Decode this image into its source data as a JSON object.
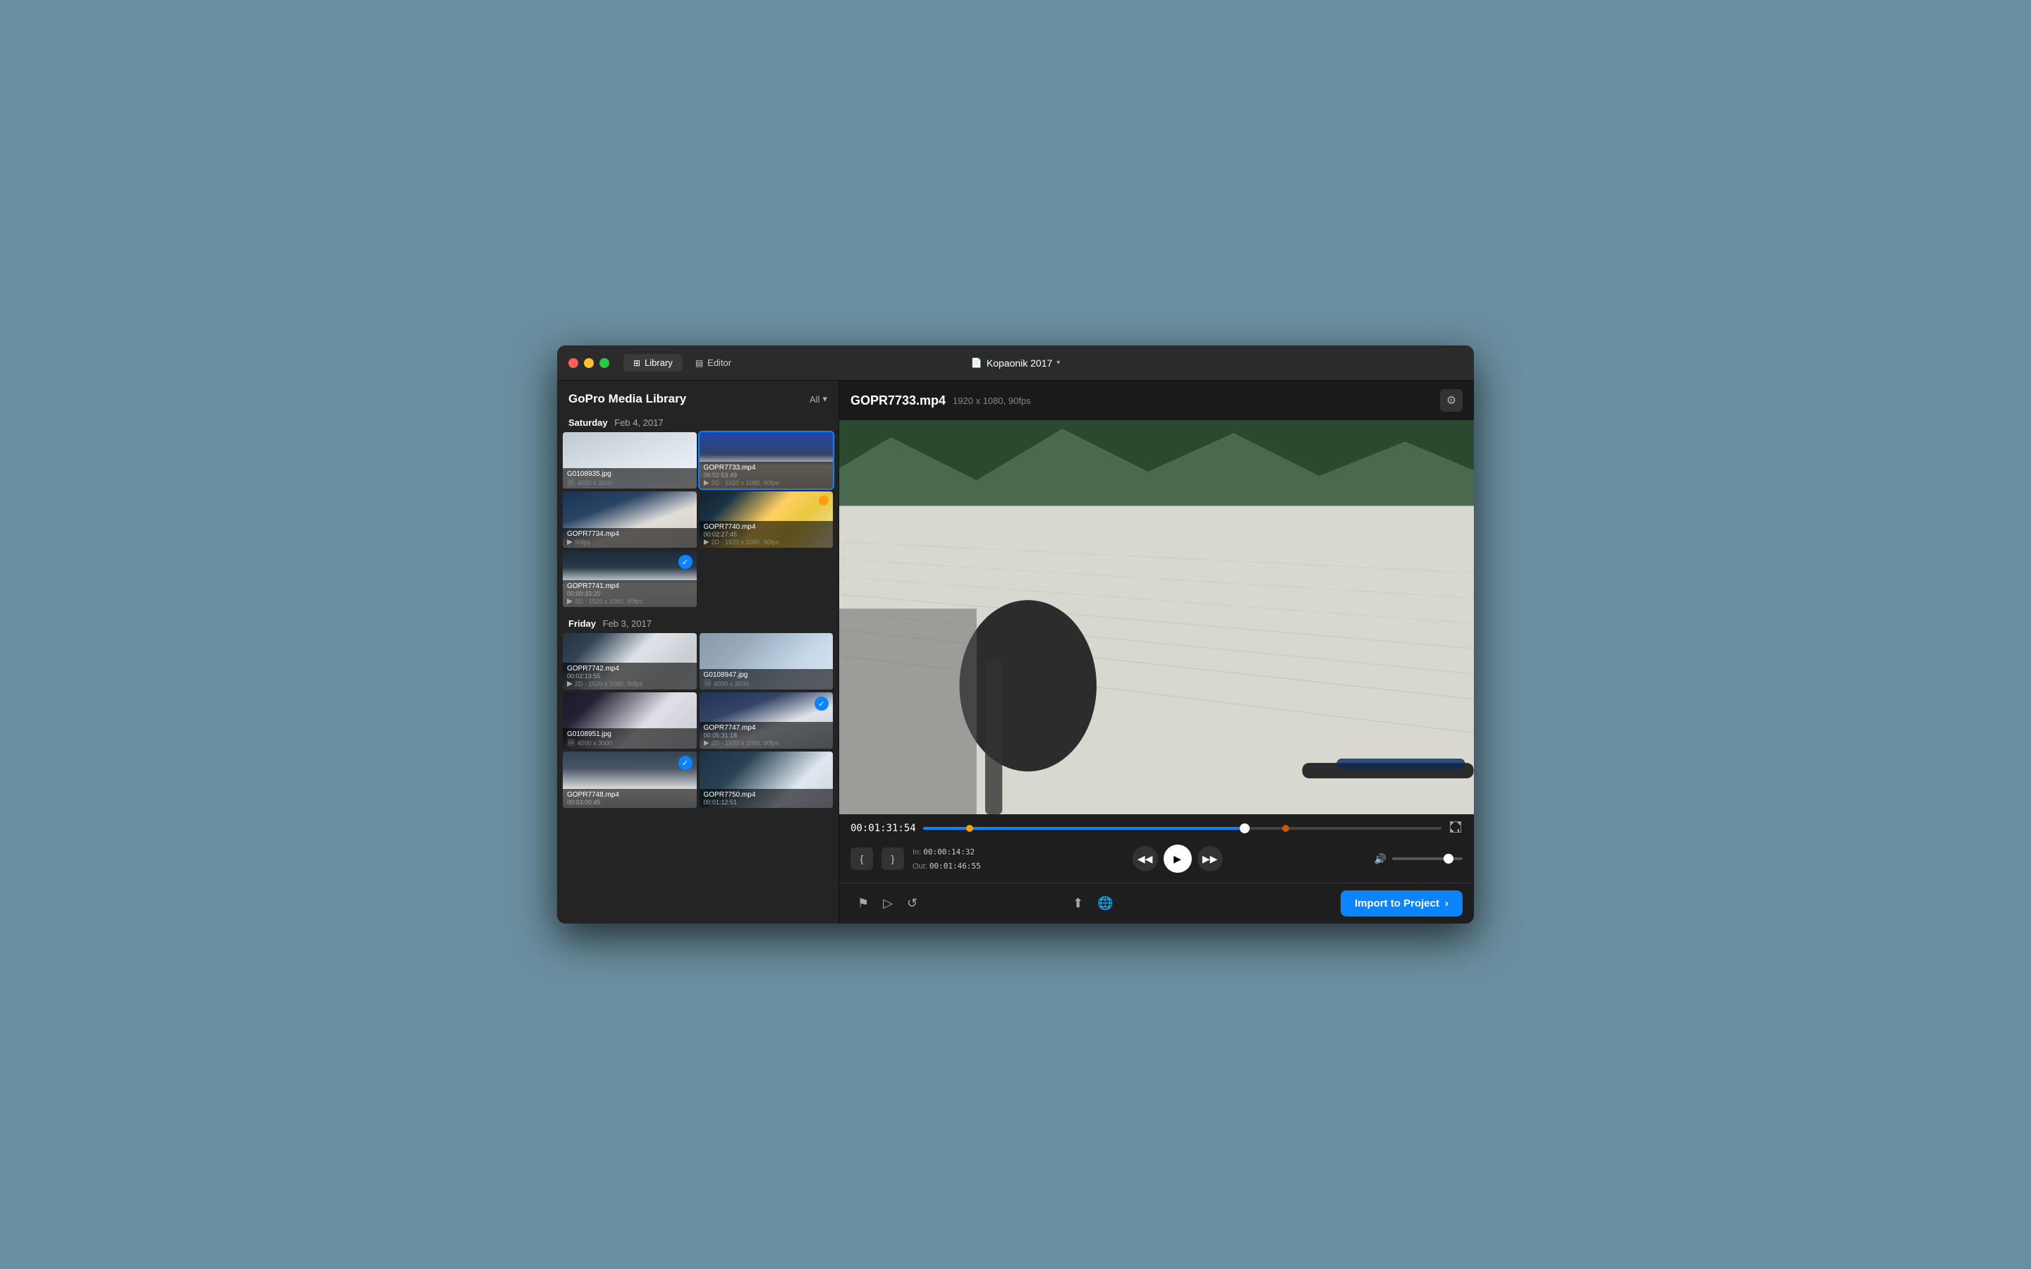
{
  "window": {
    "title": "Kopaonik 2017"
  },
  "titlebar": {
    "traffic_lights": [
      "red",
      "yellow",
      "green"
    ],
    "tabs": [
      {
        "id": "library",
        "label": "Library",
        "active": true
      },
      {
        "id": "editor",
        "label": "Editor",
        "active": false
      }
    ],
    "project_name": "Kopaonik 2017",
    "chevron": "▾"
  },
  "sidebar": {
    "title": "GoPro Media Library",
    "filter_label": "All",
    "days": [
      {
        "day": "Saturday",
        "date": "Feb 4, 2017",
        "items": [
          {
            "id": "G0108935",
            "filename": "G0108935.jpg",
            "type": "photo",
            "resolution": "4000 x 3000",
            "selected": false,
            "checked": false,
            "thumb": "thumb-photo-1"
          },
          {
            "id": "GOPR7733",
            "filename": "GOPR7733.mp4",
            "duration": "00:02:53:49",
            "type": "video",
            "meta": "2D · 1920 x 1080, 90fps",
            "selected": true,
            "checked": false,
            "thumb": "thumb-ski-2"
          },
          {
            "id": "GOPR7734",
            "filename": "GOPR7734.mp4",
            "type": "video",
            "meta": "90fps",
            "selected": false,
            "checked": false,
            "thumb": "thumb-ski-3"
          },
          {
            "id": "GOPR7740",
            "filename": "GOPR7740.mp4",
            "duration": "00:02:27:45",
            "type": "video",
            "meta": "2D · 1920 x 1080, 90fps",
            "selected": false,
            "checked": false,
            "badge": "orange",
            "thumb": "thumb-ski-4"
          },
          {
            "id": "GOPR7741",
            "filename": "GOPR7741.mp4",
            "duration": "00:00:33:20",
            "type": "video",
            "meta": "2D · 1920 x 1080, 90fps",
            "selected": false,
            "checked": true,
            "thumb": "thumb-ski-5"
          }
        ]
      },
      {
        "day": "Friday",
        "date": "Feb 3, 2017",
        "items": [
          {
            "id": "GOPR7742",
            "filename": "GOPR7742.mp4",
            "duration": "00:02:19:55",
            "type": "video",
            "meta": "2D · 1920 x 1080, 90fps",
            "selected": false,
            "checked": false,
            "thumb": "thumb-ski-6"
          },
          {
            "id": "G0108947",
            "filename": "G0108947.jpg",
            "type": "photo",
            "resolution": "4000 x 3000",
            "selected": false,
            "checked": false,
            "thumb": "thumb-photo-2"
          },
          {
            "id": "G0108951",
            "filename": "G0108951.jpg",
            "type": "photo",
            "resolution": "4000 x 3000",
            "selected": false,
            "checked": false,
            "thumb": "thumb-ski-7"
          },
          {
            "id": "GOPR7747",
            "filename": "GOPR7747.mp4",
            "duration": "00:05:31:18",
            "type": "video",
            "meta": "2D · 1920 x 1080, 90fps",
            "selected": false,
            "checked": true,
            "thumb": "thumb-ski-8"
          },
          {
            "id": "GOPR7748",
            "filename": "GOPR7748.mp4",
            "duration": "00:03:00:45",
            "type": "video",
            "meta": "",
            "selected": false,
            "checked": true,
            "thumb": "thumb-ski-9"
          },
          {
            "id": "GOPR7750",
            "filename": "GOPR7750.mp4",
            "duration": "00:01:12:51",
            "type": "video",
            "meta": "",
            "selected": false,
            "checked": false,
            "thumb": "thumb-ski-10"
          }
        ]
      }
    ]
  },
  "preview": {
    "filename": "GOPR7733.mp4",
    "resolution": "1920 x 1080, 90fps",
    "timecode": "00:01:31:54",
    "in_point": "00:00:14:32",
    "out_point": "00:01:46:55",
    "progress_percent": 62,
    "in_percent": 9,
    "out_percent": 70,
    "volume_percent": 85
  },
  "toolbar": {
    "import_label": "Import to Project",
    "import_arrow": "›"
  }
}
